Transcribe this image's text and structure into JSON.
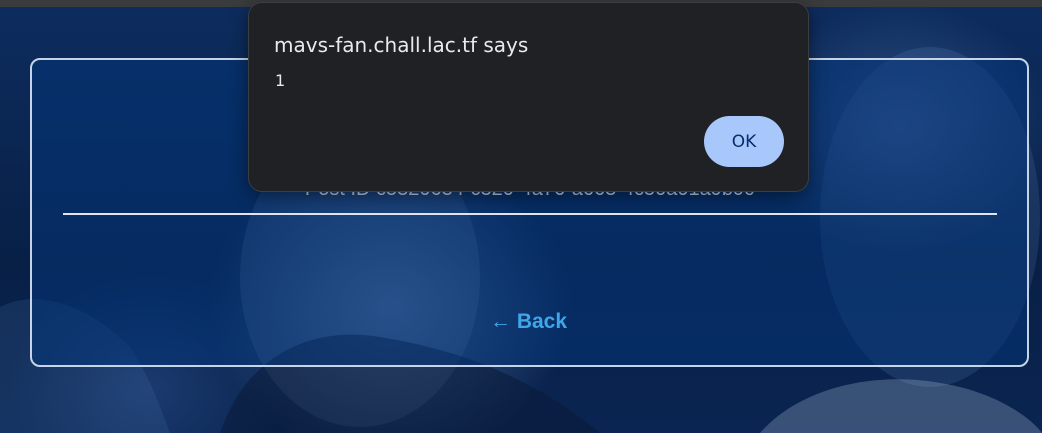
{
  "dialog": {
    "title": "mavs-fan.chall.lac.tf says",
    "message": "1",
    "ok_label": "OK"
  },
  "card": {
    "post_id": "Post ID c5320634-c320-4a76-a663-4c50a01a9b9c",
    "back_label": "← Back"
  },
  "colors": {
    "page_background": "#0a2552",
    "card_border": "#c7d3e6",
    "back_link": "#3fa6ea",
    "dialog_background": "#202124",
    "ok_button": "#a8c7fa"
  }
}
